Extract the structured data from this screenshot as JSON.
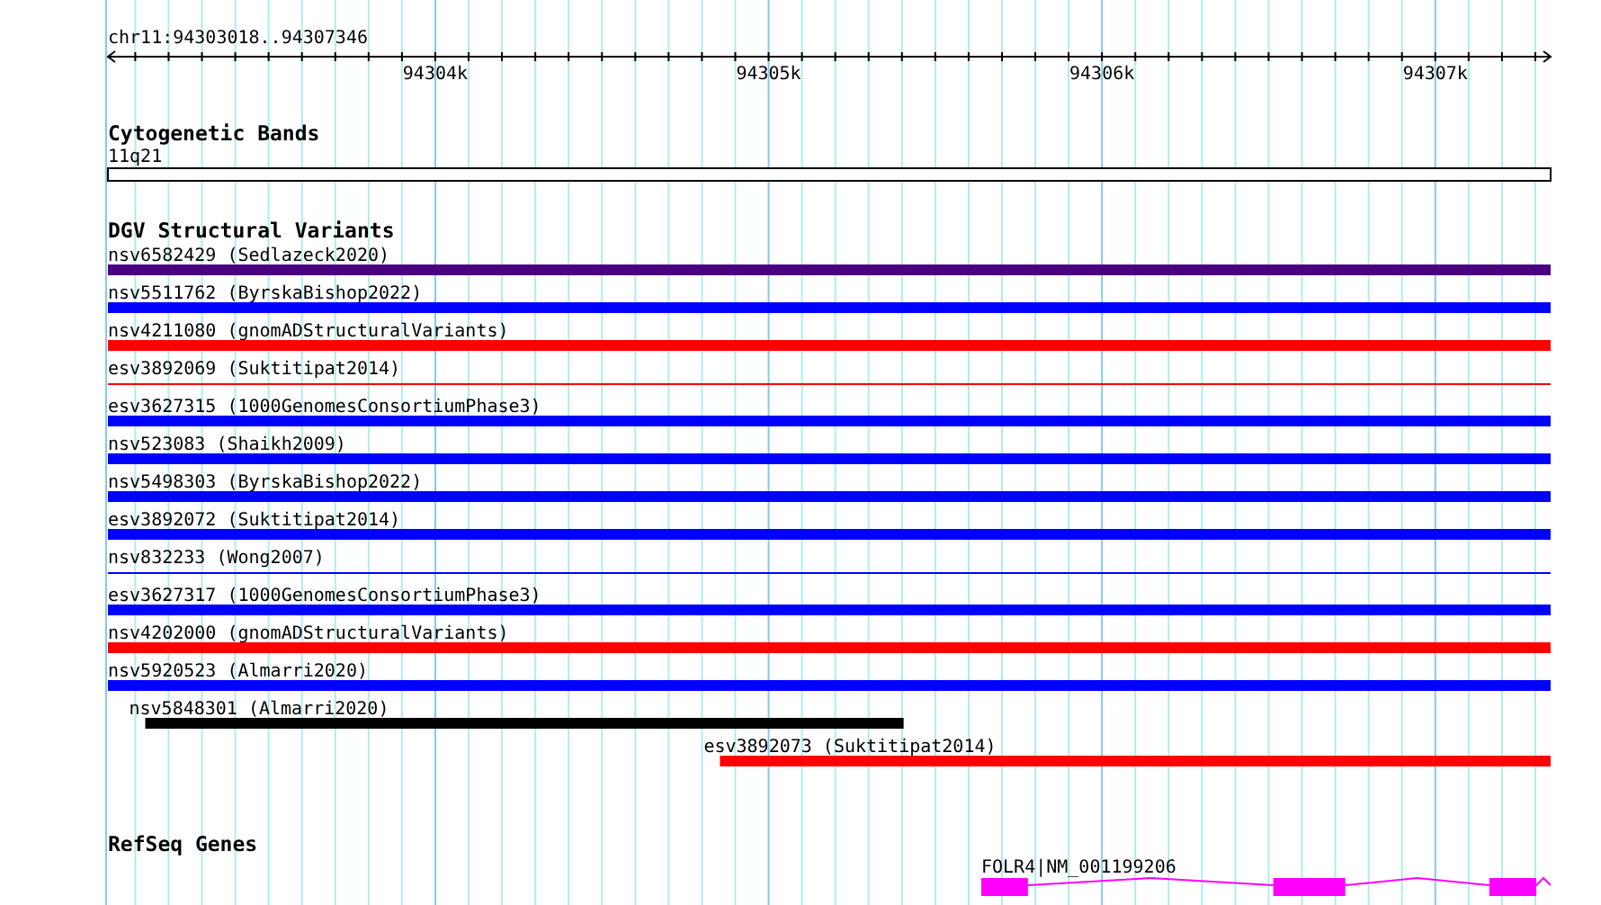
{
  "ruler": {
    "position": "chr11:94303018..94307346",
    "ticks": [
      {
        "label": "94304k"
      },
      {
        "label": "94305k"
      },
      {
        "label": "94306k"
      },
      {
        "label": "94307k"
      }
    ]
  },
  "cytogenetic_bands": {
    "title": "Cytogenetic Bands",
    "band": "11q21"
  },
  "dgv_structural_variants": {
    "title": "DGV Structural Variants",
    "items": [
      {
        "label": "nsv6582429 (Sedlazeck2020)",
        "color": "#4b0082",
        "kind": "thick"
      },
      {
        "label": "nsv5511762 (ByrskaBishop2022)",
        "color": "#0000ff",
        "kind": "thick"
      },
      {
        "label": "nsv4211080 (gnomADStructuralVariants)",
        "color": "#ff0000",
        "kind": "thick"
      },
      {
        "label": "esv3892069 (Suktitipat2014)",
        "color": "#ff0000",
        "kind": "thin"
      },
      {
        "label": "esv3627315 (1000GenomesConsortiumPhase3)",
        "color": "#0000ff",
        "kind": "thick"
      },
      {
        "label": "nsv523083 (Shaikh2009)",
        "color": "#0000ff",
        "kind": "thick"
      },
      {
        "label": "nsv5498303 (ByrskaBishop2022)",
        "color": "#0000ff",
        "kind": "thick"
      },
      {
        "label": "esv3892072 (Suktitipat2014)",
        "color": "#0000ff",
        "kind": "thick"
      },
      {
        "label": "nsv832233 (Wong2007)",
        "color": "#0000ff",
        "kind": "thin"
      },
      {
        "label": "esv3627317 (1000GenomesConsortiumPhase3)",
        "color": "#0000ff",
        "kind": "thick"
      },
      {
        "label": "nsv4202000 (gnomADStructuralVariants)",
        "color": "#ff0000",
        "kind": "thick"
      },
      {
        "label": "nsv5920523 (Almarri2020)",
        "color": "#0000ff",
        "kind": "thick"
      },
      {
        "label": "nsv5848301 (Almarri2020)",
        "color": "#000000",
        "kind": "thick"
      },
      {
        "label": "esv3892073 (Suktitipat2014)",
        "color": "#ff0000",
        "kind": "thick"
      }
    ]
  },
  "refseq_genes": {
    "title": "RefSeq Genes",
    "genes": [
      {
        "label": "FOLR4|NM_001199206",
        "color": "#ff00ff"
      }
    ]
  }
}
